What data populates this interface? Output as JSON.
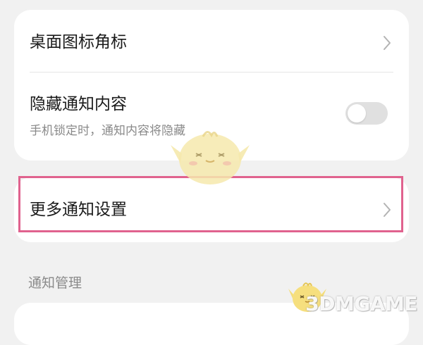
{
  "settings": {
    "badge_icon_label": "桌面图标角标",
    "hide_content": {
      "title": "隐藏通知内容",
      "subtitle": "手机锁定时，通知内容将隐藏",
      "enabled": false
    },
    "more_settings_label": "更多通知设置",
    "section_manage_label": "通知管理"
  },
  "highlight_color": "#e0628e",
  "watermark": {
    "text": "3DMGAME"
  }
}
